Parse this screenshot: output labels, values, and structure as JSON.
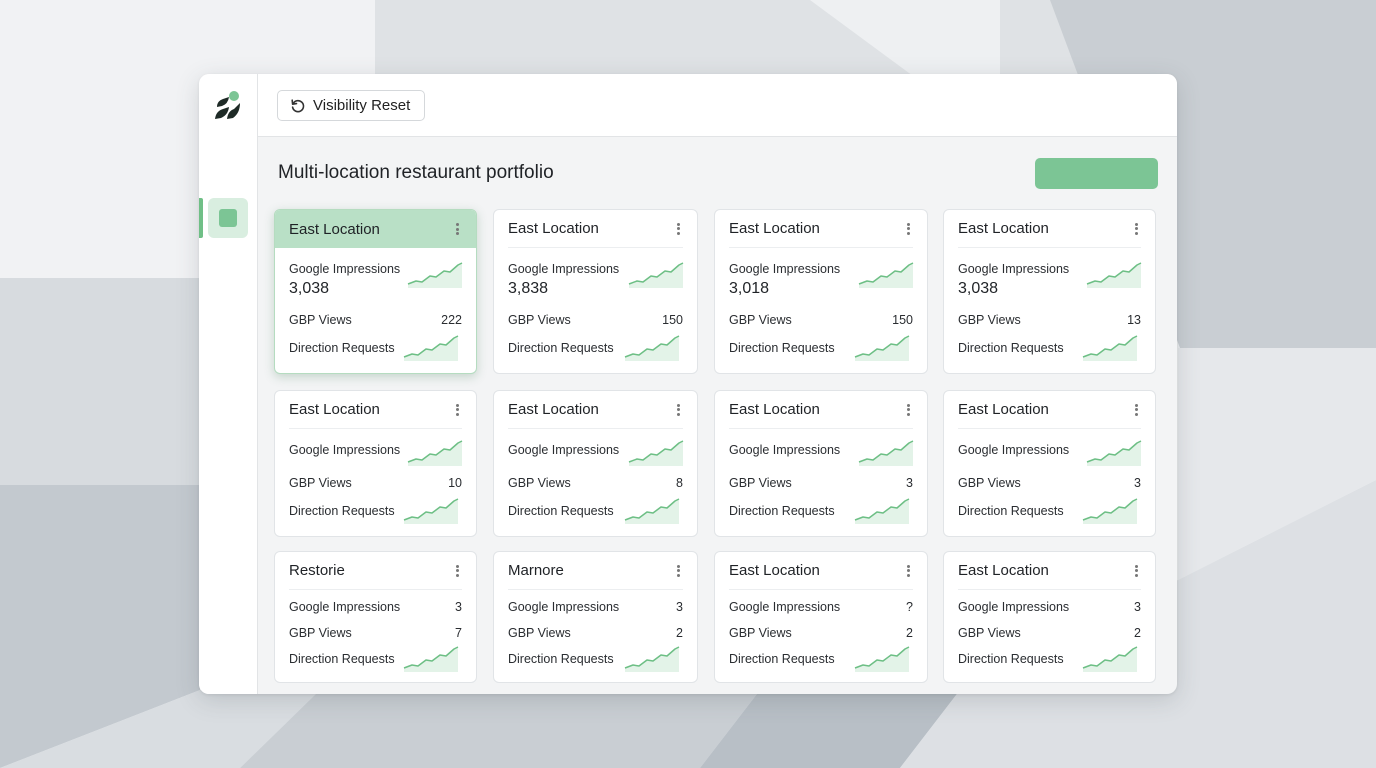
{
  "toolbar": {
    "reset_label": "Visibility Reset"
  },
  "page": {
    "title": "Multi-location restaurant portfolio"
  },
  "colors": {
    "accent": "#7cc595",
    "accent_light": "#b9e0c6",
    "sparkline": "#6dbf85"
  },
  "cards": [
    {
      "title": "East Location",
      "impressions_label": "Google Impressions",
      "impressions_value": "3,038",
      "views_label": "GBP Views",
      "views_value": "222",
      "directions_label": "Direction Requests",
      "selected": true
    },
    {
      "title": "East Location",
      "impressions_label": "Google Impressions",
      "impressions_value": "3,838",
      "views_label": "GBP Views",
      "views_value": "150",
      "directions_label": "Direction Requests"
    },
    {
      "title": "East Location",
      "impressions_label": "Google Impressions",
      "impressions_value": "3,018",
      "views_label": "GBP Views",
      "views_value": "150",
      "directions_label": "Direction Requests"
    },
    {
      "title": "East Location",
      "impressions_label": "Google Impressions",
      "impressions_value": "3,038",
      "views_label": "GBP Views",
      "views_value": "13",
      "directions_label": "Direction Requests"
    },
    {
      "title": "East Location",
      "impressions_label": "Google Impressions",
      "views_label": "GBP Views",
      "views_value": "10",
      "directions_label": "Direction Requests"
    },
    {
      "title": "East Location",
      "impressions_label": "Google Impressions",
      "views_label": "GBP Views",
      "views_value": "8",
      "directions_label": "Direction Requests"
    },
    {
      "title": "East Location",
      "impressions_label": "Google Impressions",
      "views_label": "GBP Views",
      "views_value": "3",
      "directions_label": "Direction Requests"
    },
    {
      "title": "East Location",
      "impressions_label": "Google Impressions",
      "views_label": "GBP Views",
      "views_value": "3",
      "directions_label": "Direction Requests"
    },
    {
      "title": "Restorie",
      "impressions_label": "Google Impressions",
      "impressions_small": "3",
      "views_label": "GBP Views",
      "views_value": "7",
      "directions_label": "Direction Requests"
    },
    {
      "title": "Marnore",
      "impressions_label": "Google Impressions",
      "impressions_small": "3",
      "views_label": "GBP Views",
      "views_value": "2",
      "directions_label": "Direction Requests"
    },
    {
      "title": "East Location",
      "impressions_label": "Google Impressions",
      "impressions_small": "?",
      "views_label": "GBP Views",
      "views_value": "2",
      "directions_label": "Direction Requests"
    },
    {
      "title": "East Location",
      "impressions_label": "Google Impressions",
      "impressions_small": "3",
      "views_label": "GBP Views",
      "views_value": "2",
      "directions_label": "Direction Requests"
    }
  ],
  "icons": {
    "logo": "leaf-logo-icon",
    "reset": "refresh-icon",
    "menu": "kebab-menu-icon",
    "trend": "sparkline-icon"
  }
}
